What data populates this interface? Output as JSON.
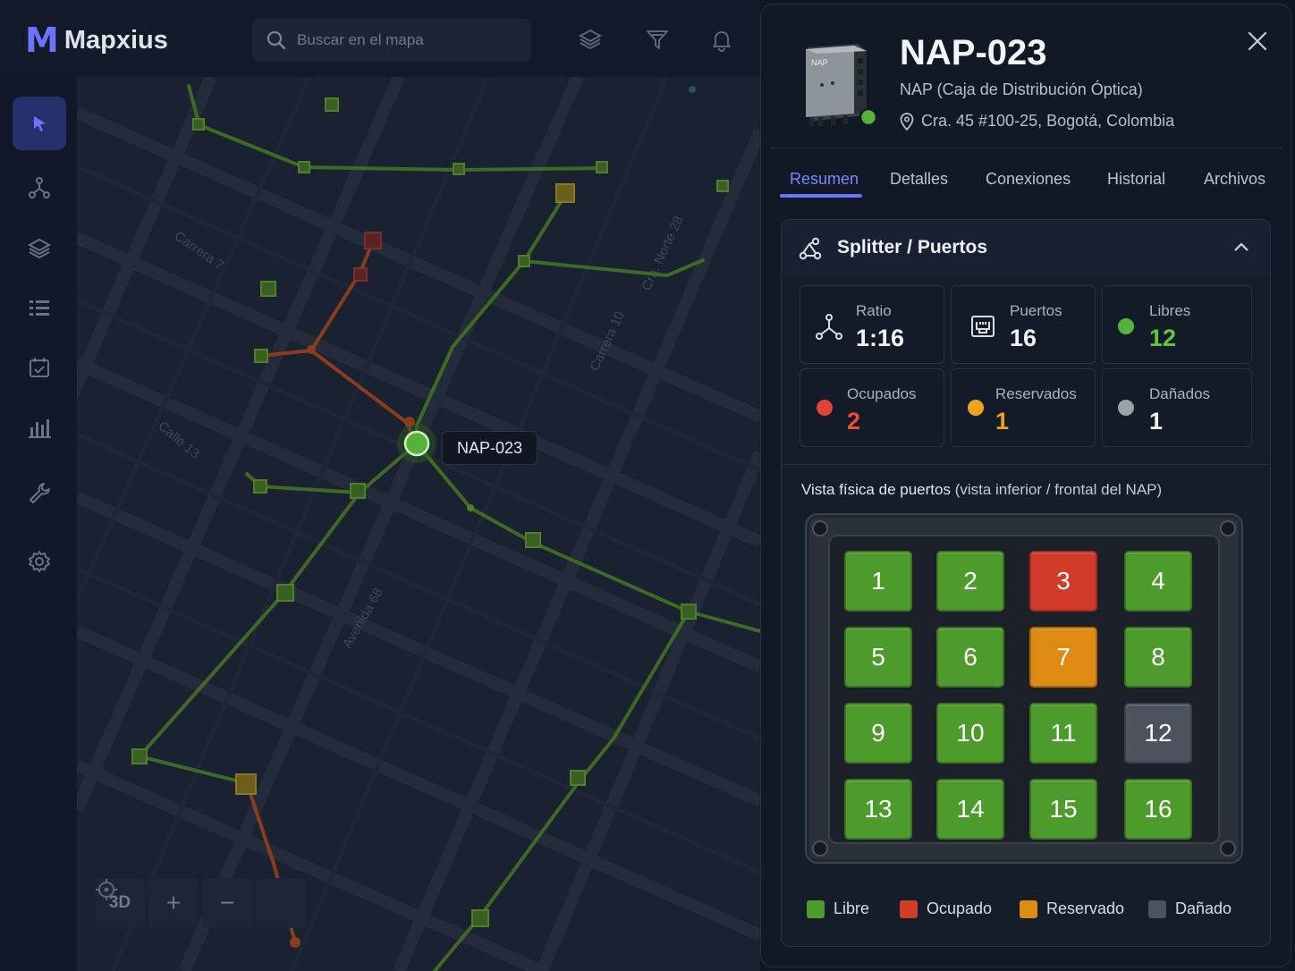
{
  "app": {
    "name": "Mapxius",
    "logo_mark": "M"
  },
  "search": {
    "placeholder": "Buscar en el mapa"
  },
  "top_icons": [
    "layers-icon",
    "filter-icon",
    "bell-icon"
  ],
  "sidebar": {
    "items": [
      {
        "name": "select-tool",
        "icon": "cursor-icon",
        "active": true
      },
      {
        "name": "network",
        "icon": "network-icon"
      },
      {
        "name": "layers",
        "icon": "layers-icon"
      },
      {
        "name": "list",
        "icon": "list-icon"
      },
      {
        "name": "tasks",
        "icon": "calendar-check-icon"
      },
      {
        "name": "reports",
        "icon": "bar-chart-icon"
      },
      {
        "name": "tools",
        "icon": "wrench-icon"
      },
      {
        "name": "settings",
        "icon": "gear-icon"
      }
    ]
  },
  "map": {
    "selected_label": "NAP-023",
    "street_labels": [
      "Carrera 7",
      "Calle 13",
      "Carrera 10",
      "Cra. Norte 28",
      "Avenida 68"
    ],
    "controls": {
      "mode_3d": "3D",
      "zoom_in": "+",
      "zoom_out": "−"
    }
  },
  "panel": {
    "title": "NAP-023",
    "subtitle": "NAP (Caja de Distribución Óptica)",
    "address": "Cra. 45 #100-25, Bogotá, Colombia",
    "device_label": "NAP",
    "tabs": [
      "Resumen",
      "Detalles",
      "Conexiones",
      "Historial",
      "Archivos"
    ],
    "active_tab": "Resumen",
    "section": {
      "title": "Splitter / Puertos",
      "stats": {
        "ratio": {
          "label": "Ratio",
          "value": "1:16"
        },
        "puertos": {
          "label": "Puertos",
          "value": "16"
        },
        "libres": {
          "label": "Libres",
          "value": "12"
        },
        "ocupados": {
          "label": "Ocupados",
          "value": "2"
        },
        "reservados": {
          "label": "Reservados",
          "value": "1"
        },
        "danados": {
          "label": "Dañados",
          "value": "1"
        }
      },
      "ports_title": "Vista física de puertos",
      "ports_subtitle": "(vista inferior / frontal del NAP)",
      "ports": [
        {
          "n": "1",
          "status": "libre"
        },
        {
          "n": "2",
          "status": "libre"
        },
        {
          "n": "3",
          "status": "ocupado"
        },
        {
          "n": "4",
          "status": "libre"
        },
        {
          "n": "5",
          "status": "libre"
        },
        {
          "n": "6",
          "status": "libre"
        },
        {
          "n": "7",
          "status": "reservado"
        },
        {
          "n": "8",
          "status": "libre"
        },
        {
          "n": "9",
          "status": "libre"
        },
        {
          "n": "10",
          "status": "libre"
        },
        {
          "n": "11",
          "status": "libre"
        },
        {
          "n": "12",
          "status": "danado"
        },
        {
          "n": "13",
          "status": "libre"
        },
        {
          "n": "14",
          "status": "libre"
        },
        {
          "n": "15",
          "status": "libre"
        },
        {
          "n": "16",
          "status": "libre"
        }
      ],
      "legend": {
        "libre": "Libre",
        "ocupado": "Ocupado",
        "reservado": "Reservado",
        "danado": "Dañado"
      }
    }
  },
  "colors": {
    "accent": "#6b73ff",
    "libre": "#4e9b2d",
    "ocupado": "#d23a2a",
    "reservado": "#df8a12",
    "danado": "#4c535f",
    "libres_text": "#5cc83a",
    "ocupados_text": "#ef4a3a",
    "reservados_text": "#f0a21e"
  }
}
